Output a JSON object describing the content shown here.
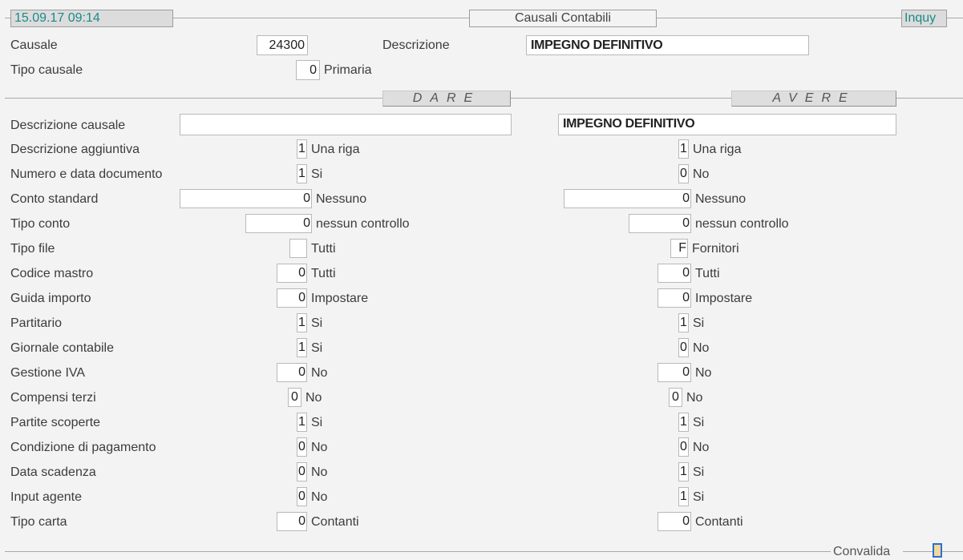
{
  "header": {
    "datetime": "15.09.17 09:14",
    "title": "Causali Contabili",
    "mode": "Inquy"
  },
  "causale": {
    "label": "Causale",
    "value": "24300"
  },
  "descrizione": {
    "label": "Descrizione",
    "value": "IMPEGNO DEFINITIVO"
  },
  "tipo_causale": {
    "label": "Tipo causale",
    "code": "0",
    "text": "Primaria"
  },
  "sections": {
    "dare": "DARE",
    "avere": "AVERE"
  },
  "descrizione_causale": {
    "label": "Descrizione causale",
    "dare": "",
    "avere": "IMPEGNO DEFINITIVO"
  },
  "rows": [
    {
      "label": "Descrizione aggiuntiva",
      "dare_code": "1",
      "dare_text": "Una riga",
      "avere_code": "1",
      "avere_text": "Una riga"
    },
    {
      "label": "Numero e data documento",
      "dare_code": "1",
      "dare_text": "Si",
      "avere_code": "0",
      "avere_text": "No"
    },
    {
      "label": "Conto standard",
      "dare_code": "0",
      "dare_text": "Nessuno",
      "avere_code": "0",
      "avere_text": "Nessuno"
    },
    {
      "label": "Tipo conto",
      "dare_code": "0",
      "dare_text": "nessun controllo",
      "avere_code": "0",
      "avere_text": "nessun controllo"
    },
    {
      "label": "Tipo file",
      "dare_code": "",
      "dare_text": "Tutti",
      "avere_code": "F",
      "avere_text": "Fornitori"
    },
    {
      "label": "Codice mastro",
      "dare_code": "0",
      "dare_text": "Tutti",
      "avere_code": "0",
      "avere_text": "Tutti"
    },
    {
      "label": "Guida importo",
      "dare_code": "0",
      "dare_text": "Impostare",
      "avere_code": "0",
      "avere_text": "Impostare"
    },
    {
      "label": "Partitario",
      "dare_code": "1",
      "dare_text": "Si",
      "avere_code": "1",
      "avere_text": "Si"
    },
    {
      "label": "Giornale contabile",
      "dare_code": "1",
      "dare_text": "Si",
      "avere_code": "0",
      "avere_text": "No"
    },
    {
      "label": "Gestione IVA",
      "dare_code": "0",
      "dare_text": "No",
      "avere_code": "0",
      "avere_text": "No"
    },
    {
      "label": "Compensi terzi",
      "dare_code": "0",
      "dare_text": "No",
      "avere_code": "0",
      "avere_text": "No"
    },
    {
      "label": "Partite scoperte",
      "dare_code": "1",
      "dare_text": "Si",
      "avere_code": "1",
      "avere_text": "Si"
    },
    {
      "label": "Condizione di pagamento",
      "dare_code": "0",
      "dare_text": "No",
      "avere_code": "0",
      "avere_text": "No"
    },
    {
      "label": "Data scadenza",
      "dare_code": "0",
      "dare_text": "No",
      "avere_code": "1",
      "avere_text": "Si"
    },
    {
      "label": "Input agente",
      "dare_code": "0",
      "dare_text": "No",
      "avere_code": "1",
      "avere_text": "Si"
    },
    {
      "label": "Tipo carta",
      "dare_code": "0",
      "dare_text": "Contanti",
      "avere_code": "0",
      "avere_text": "Contanti"
    }
  ],
  "footer": {
    "convalida": "Convalida"
  }
}
